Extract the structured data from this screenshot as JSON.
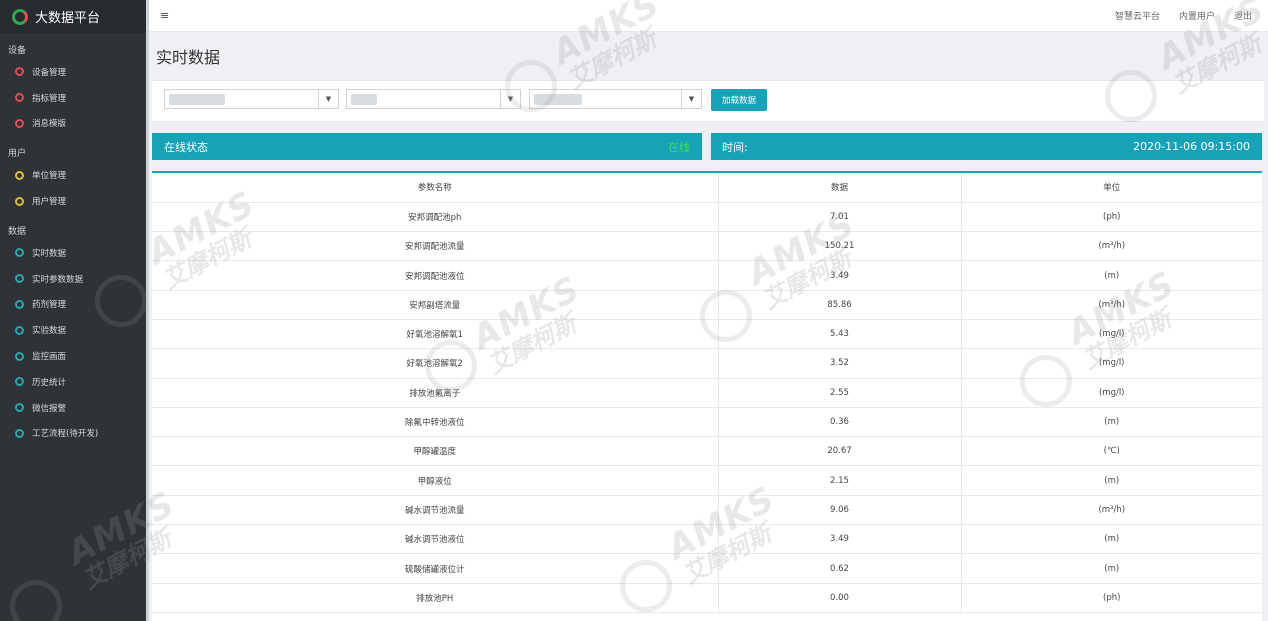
{
  "app": {
    "title": "大数据平台"
  },
  "sidebar": {
    "sections": [
      {
        "title": "设备",
        "items": [
          {
            "label": "设备管理",
            "color": "#e04f4f"
          },
          {
            "label": "指标管理",
            "color": "#e04f4f"
          },
          {
            "label": "消息模版",
            "color": "#e04f4f"
          }
        ]
      },
      {
        "title": "用户",
        "items": [
          {
            "label": "单位管理",
            "color": "#e2b93b"
          },
          {
            "label": "用户管理",
            "color": "#e2b93b"
          }
        ]
      },
      {
        "title": "数据",
        "items": [
          {
            "label": "实时数据",
            "color": "#2ba5ab"
          },
          {
            "label": "实时参数数据",
            "color": "#2ba5ab"
          },
          {
            "label": "药剂管理",
            "color": "#2ba5ab"
          },
          {
            "label": "实验数据",
            "color": "#2ba5ab"
          },
          {
            "label": "监控画面",
            "color": "#2ba5ab"
          },
          {
            "label": "历史统计",
            "color": "#2ba5ab"
          },
          {
            "label": "微信报警",
            "color": "#2ba5ab"
          },
          {
            "label": "工艺流程(待开发)",
            "color": "#2ba5ab"
          }
        ]
      }
    ]
  },
  "header": {
    "menu_icon": "≡",
    "links": [
      "智慧云平台",
      "内置用户",
      "退出"
    ]
  },
  "page": {
    "title": "实时数据"
  },
  "filters": {
    "load_button": "加载数据"
  },
  "status": {
    "label": "在线状态",
    "value": "在线",
    "time_label": "时间:",
    "time_value": "2020-11-06 09:15:00"
  },
  "table": {
    "headers": [
      "参数名称",
      "数据",
      "单位"
    ],
    "rows": [
      [
        "安邦调配池ph",
        "7.01",
        "(ph)"
      ],
      [
        "安邦调配池流量",
        "150.21",
        "(m³/h)"
      ],
      [
        "安邦调配池液位",
        "3.49",
        "(m)"
      ],
      [
        "安邦副塔流量",
        "85.86",
        "(m³/h)"
      ],
      [
        "好氧池溶解氧1",
        "5.43",
        "(mg/l)"
      ],
      [
        "好氧池溶解氧2",
        "3.52",
        "(mg/l)"
      ],
      [
        "排放池氟离子",
        "2.55",
        "(mg/l)"
      ],
      [
        "除氟中转池液位",
        "0.36",
        "(m)"
      ],
      [
        "甲醇罐温度",
        "20.67",
        "(℃)"
      ],
      [
        "甲醇液位",
        "2.15",
        "(m)"
      ],
      [
        "碱水调节池流量",
        "9.06",
        "(m³/h)"
      ],
      [
        "碱水调节池液位",
        "3.49",
        "(m)"
      ],
      [
        "硫酸储罐液位计",
        "0.62",
        "(m)"
      ],
      [
        "排放池PH",
        "0.00",
        "(ph)"
      ]
    ]
  },
  "watermark": {
    "line1": "AMKS",
    "line2": "艾摩柯斯"
  }
}
